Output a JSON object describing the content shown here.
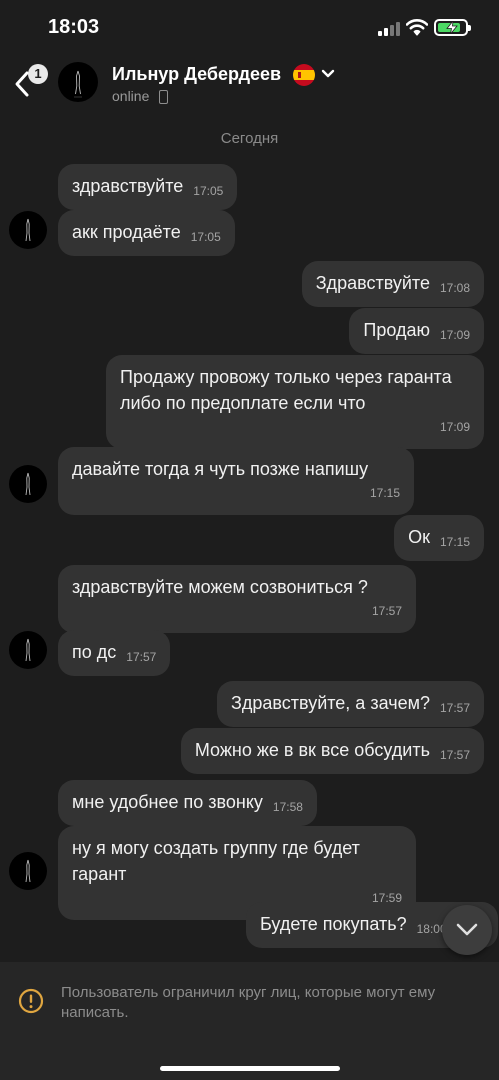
{
  "status_bar": {
    "time": "18:03"
  },
  "header": {
    "back_badge": "1",
    "name": "Ильнур Дебердеев",
    "status": "online"
  },
  "date_separator": "Сегодня",
  "messages": [
    {
      "side": "in",
      "text": "здравствуйте",
      "time": "17:05"
    },
    {
      "side": "in",
      "text": "акк продаёте",
      "time": "17:05"
    },
    {
      "side": "out",
      "text": "Здравствуйте",
      "time": "17:08"
    },
    {
      "side": "out",
      "text": "Продаю",
      "time": "17:09"
    },
    {
      "side": "out",
      "text": "Продажу провожу только через гаранта либо по предоплате если что",
      "time": "17:09"
    },
    {
      "side": "in",
      "text": "давайте тогда я чуть позже напишу",
      "time": "17:15"
    },
    {
      "side": "out",
      "text": "Ок",
      "time": "17:15"
    },
    {
      "side": "in",
      "text": "здравствуйте можем созвониться ?",
      "time": "17:57"
    },
    {
      "side": "in",
      "text": "по дс",
      "time": "17:57"
    },
    {
      "side": "out",
      "text": "Здравствуйте, а зачем?",
      "time": "17:57"
    },
    {
      "side": "out",
      "text": "Можно же в вк все обсудить",
      "time": "17:57"
    },
    {
      "side": "in",
      "text": "мне удобнее по звонку",
      "time": "17:58"
    },
    {
      "side": "in",
      "text": "ну я могу создать группу где будет гарант",
      "time": "17:59"
    },
    {
      "side": "out",
      "text": "Будете покупать?",
      "time": "18:00"
    }
  ],
  "footer": {
    "restriction_text": "Пользователь ограничил круг лиц, которые могут ему написать."
  },
  "icons": {
    "back": "chevron-left-icon",
    "header_dropdown": "chevron-down-icon",
    "scroll_down": "chevron-down-icon",
    "warning": "exclamation-circle-icon"
  },
  "colors": {
    "background": "#1d1d1d",
    "bubble": "#333333",
    "footer": "#262626",
    "warning": "#e0a640",
    "battery": "#4cd964"
  }
}
